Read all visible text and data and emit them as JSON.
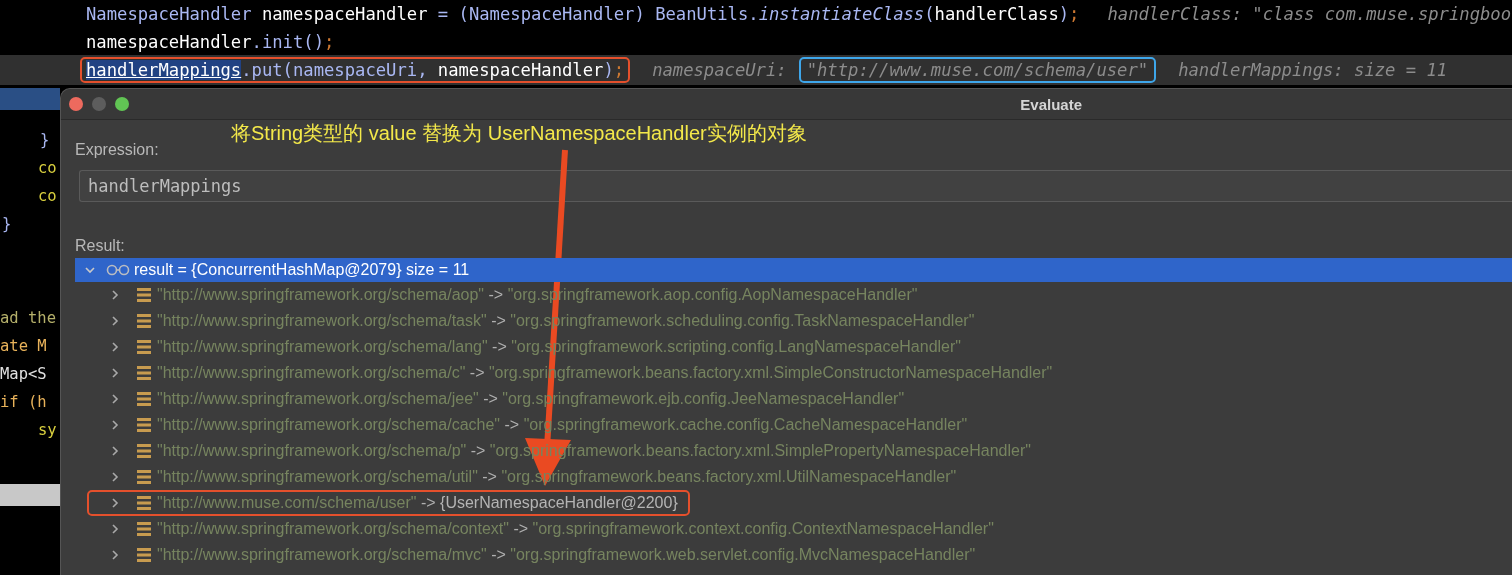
{
  "editor": {
    "lines": [
      {
        "current": false,
        "boxed": false,
        "tokens": [
          {
            "t": "NamespaceHandler ",
            "kind": "type"
          },
          {
            "t": "namespaceHandler ",
            "kind": "plain"
          },
          {
            "t": "= (NamespaceHandler) BeanUtils.",
            "kind": "type"
          },
          {
            "t": "instantiateClass",
            "kind": "static"
          },
          {
            "t": "(",
            "kind": "type"
          },
          {
            "t": "handlerClass",
            "kind": "plain"
          },
          {
            "t": ")",
            "kind": "type"
          },
          {
            "t": ";",
            "kind": "punct"
          }
        ],
        "hints": [
          {
            "text": "handlerClass: \"class com.muse.springboo",
            "boxed": false
          }
        ]
      },
      {
        "current": false,
        "boxed": false,
        "tokens": [
          {
            "t": "namespaceHandler",
            "kind": "plain"
          },
          {
            "t": ".init()",
            "kind": "type"
          },
          {
            "t": ";",
            "kind": "punct"
          }
        ]
      },
      {
        "current": true,
        "boxed": true,
        "tokens": [
          {
            "t": "handlerMappings",
            "kind": "selected"
          },
          {
            "t": ".put(namespaceUri, ",
            "kind": "type"
          },
          {
            "t": "namespaceHandler",
            "kind": "plain"
          },
          {
            "t": ")",
            "kind": "type"
          },
          {
            "t": ";",
            "kind": "punct"
          }
        ],
        "hints": [
          {
            "text": "namespaceUri:",
            "boxed": false
          },
          {
            "text": "\"http://www.muse.com/schema/user\"",
            "boxed": true
          },
          {
            "text": "handlerMappings:  size = 11",
            "boxed": false
          }
        ]
      }
    ]
  },
  "left_gutter": {
    "lines": [
      {
        "text": "}",
        "kind": "brace"
      },
      {
        "text": "co",
        "kind": "field"
      },
      {
        "text": "co",
        "kind": "field"
      },
      {
        "text": "}",
        "kind": "brace"
      },
      {
        "text": "ad the",
        "kind": "comment"
      },
      {
        "text": "ate M",
        "kind": "keyword"
      },
      {
        "text": "Map<S",
        "kind": "plain"
      },
      {
        "text": "if (h",
        "kind": "keyword"
      },
      {
        "text": "sy",
        "kind": "field"
      }
    ]
  },
  "dialog": {
    "title": "Evaluate",
    "window_buttons": [
      {
        "kind": "close",
        "disabled": false
      },
      {
        "kind": "minimize",
        "disabled": true
      },
      {
        "kind": "zoom",
        "disabled": false
      }
    ],
    "annotation": "将String类型的 value 替换为 UserNamespaceHandler实例的对象",
    "expression_label": "Expression:",
    "expression": "handlerMappings",
    "result_label": "Result:",
    "root": {
      "text": "result = {ConcurrentHashMap@2079}  size = 11",
      "expanded": true,
      "selected": true,
      "children": [
        {
          "key": "\"http://www.springframework.org/schema/aop\"",
          "sep": "->",
          "value": "\"org.springframework.aop.config.AopNamespaceHandler\"",
          "kind": "string",
          "boxed": false,
          "expanded": false
        },
        {
          "key": "\"http://www.springframework.org/schema/task\"",
          "sep": "->",
          "value": "\"org.springframework.scheduling.config.TaskNamespaceHandler\"",
          "kind": "string",
          "boxed": false,
          "expanded": false
        },
        {
          "key": "\"http://www.springframework.org/schema/lang\"",
          "sep": "->",
          "value": "\"org.springframework.scripting.config.LangNamespaceHandler\"",
          "kind": "string",
          "boxed": false,
          "expanded": false
        },
        {
          "key": "\"http://www.springframework.org/schema/c\"",
          "sep": "->",
          "value": "\"org.springframework.beans.factory.xml.SimpleConstructorNamespaceHandler\"",
          "kind": "string",
          "boxed": false,
          "expanded": false
        },
        {
          "key": "\"http://www.springframework.org/schema/jee\"",
          "sep": "->",
          "value": "\"org.springframework.ejb.config.JeeNamespaceHandler\"",
          "kind": "string",
          "boxed": false,
          "expanded": false
        },
        {
          "key": "\"http://www.springframework.org/schema/cache\"",
          "sep": "->",
          "value": "\"org.springframework.cache.config.CacheNamespaceHandler\"",
          "kind": "string",
          "boxed": false,
          "expanded": false
        },
        {
          "key": "\"http://www.springframework.org/schema/p\"",
          "sep": "->",
          "value": "\"org.springframework.beans.factory.xml.SimplePropertyNamespaceHandler\"",
          "kind": "string",
          "boxed": false,
          "expanded": false
        },
        {
          "key": "\"http://www.springframework.org/schema/util\"",
          "sep": "->",
          "value": "\"org.springframework.beans.factory.xml.UtilNamespaceHandler\"",
          "kind": "string",
          "boxed": false,
          "expanded": false
        },
        {
          "key": "\"http://www.muse.com/schema/user\"",
          "sep": "->",
          "value": "{UserNamespaceHandler@2200}",
          "kind": "object",
          "boxed": true,
          "expanded": false
        },
        {
          "key": "\"http://www.springframework.org/schema/context\"",
          "sep": "->",
          "value": "\"org.springframework.context.config.ContextNamespaceHandler\"",
          "kind": "string",
          "boxed": false,
          "expanded": false
        },
        {
          "key": "\"http://www.springframework.org/schema/mvc\"",
          "sep": "->",
          "value": "\"org.springframework.web.servlet.config.MvcNamespaceHandler\"",
          "kind": "string",
          "boxed": false,
          "expanded": false
        }
      ]
    }
  }
}
